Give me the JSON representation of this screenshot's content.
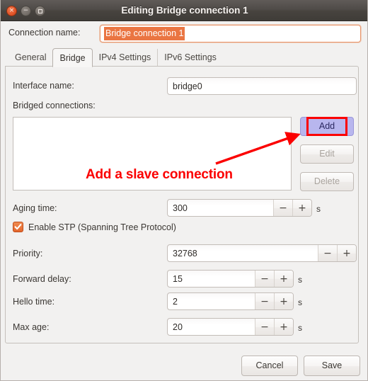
{
  "window": {
    "title": "Editing Bridge connection 1",
    "controls": {
      "close": "×",
      "minimize": "−",
      "maximize": ""
    }
  },
  "connection": {
    "label": "Connection name:",
    "value": "Bridge connection 1",
    "selected": true
  },
  "tabs": [
    {
      "label": "General",
      "active": false
    },
    {
      "label": "Bridge",
      "active": true
    },
    {
      "label": "IPv4 Settings",
      "active": false
    },
    {
      "label": "IPv6 Settings",
      "active": false
    }
  ],
  "bridge": {
    "interface_name": {
      "label": "Interface name:",
      "value": "bridge0"
    },
    "bridged_connections": {
      "label": "Bridged connections:",
      "items": []
    },
    "side_buttons": [
      {
        "label": "Add",
        "enabled": true,
        "highlighted": true
      },
      {
        "label": "Edit",
        "enabled": false,
        "highlighted": false
      },
      {
        "label": "Delete",
        "enabled": false,
        "highlighted": false
      }
    ],
    "aging_time": {
      "label": "Aging time:",
      "value": "300",
      "unit": "s",
      "minus": "−",
      "plus": "+"
    },
    "stp": {
      "label": "Enable STP (Spanning Tree Protocol)",
      "checked": true
    },
    "priority": {
      "label": "Priority:",
      "value": "32768",
      "unit": "",
      "minus": "−",
      "plus": "+"
    },
    "forward_delay": {
      "label": "Forward delay:",
      "value": "15",
      "unit": "s",
      "minus": "−",
      "plus": "+"
    },
    "hello_time": {
      "label": "Hello time:",
      "value": "2",
      "unit": "s",
      "minus": "−",
      "plus": "+"
    },
    "max_age": {
      "label": "Max age:",
      "value": "20",
      "unit": "s",
      "minus": "−",
      "plus": "+"
    }
  },
  "annotation": {
    "text": "Add a slave connection",
    "color": "#fb0000",
    "highlight_border_color": "#fb0000",
    "highlight_fill_color": "#b8b6ee"
  },
  "footer": {
    "cancel": "Cancel",
    "save": "Save"
  },
  "colors": {
    "titlebar": "#4e4a47",
    "accent_orange": "#ea7542",
    "window_bg": "#f2f1f0"
  }
}
